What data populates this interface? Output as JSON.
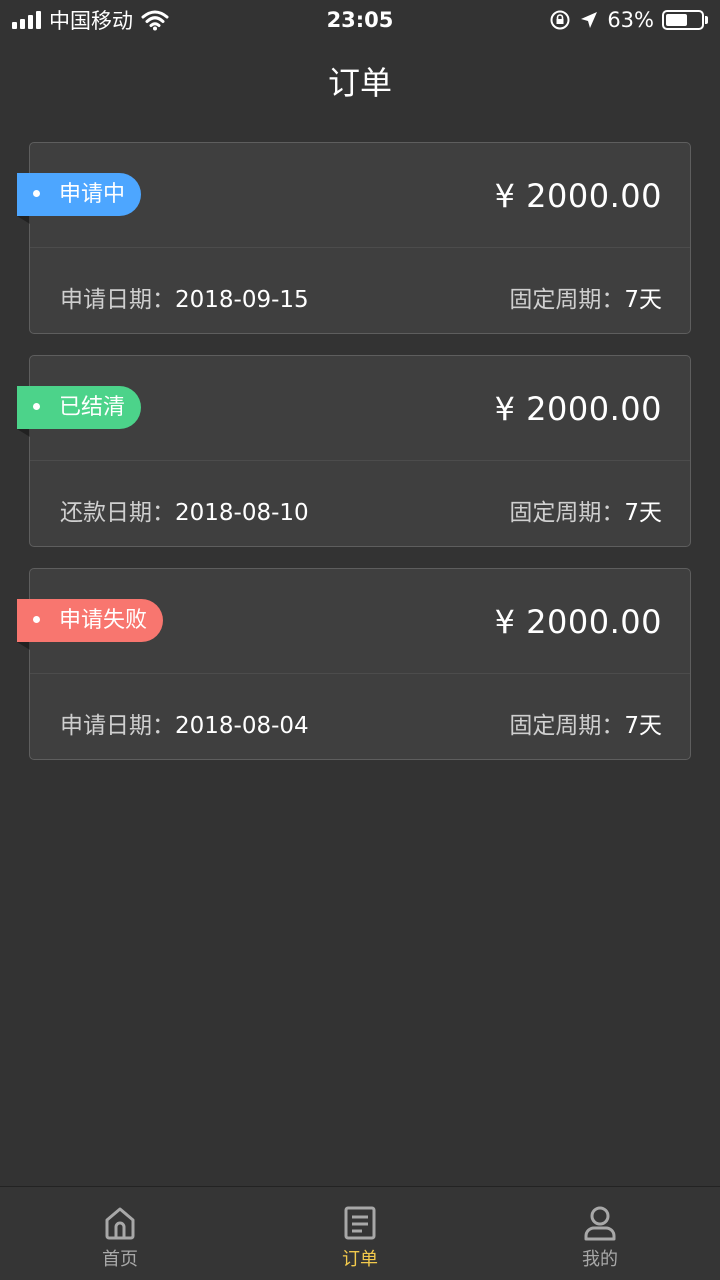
{
  "status_bar": {
    "carrier": "中国移动",
    "time": "23:05",
    "battery_percent": "63%",
    "battery_level": 0.63
  },
  "nav": {
    "title": "订单"
  },
  "colors": {
    "applying": "#4da6ff",
    "settled": "#4cd38a",
    "failed": "#f8766f",
    "active_tab": "#f2c94c"
  },
  "orders": [
    {
      "status": "申请中",
      "status_color": "#4da6ff",
      "amount": "¥ 2000.00",
      "date_label": "申请日期：",
      "date_value": "2018-09-15",
      "period_label": "固定周期：",
      "period_value": "7天"
    },
    {
      "status": "已结清",
      "status_color": "#4cd38a",
      "amount": "¥ 2000.00",
      "date_label": "还款日期：",
      "date_value": "2018-08-10",
      "period_label": "固定周期：",
      "period_value": "7天"
    },
    {
      "status": "申请失败",
      "status_color": "#f8766f",
      "amount": "¥ 2000.00",
      "date_label": "申请日期：",
      "date_value": "2018-08-04",
      "period_label": "固定周期：",
      "period_value": "7天"
    }
  ],
  "tab_bar": {
    "items": [
      {
        "label": "首页",
        "icon": "home-icon",
        "active": false
      },
      {
        "label": "订单",
        "icon": "document-icon",
        "active": true
      },
      {
        "label": "我的",
        "icon": "user-icon",
        "active": false
      }
    ]
  }
}
